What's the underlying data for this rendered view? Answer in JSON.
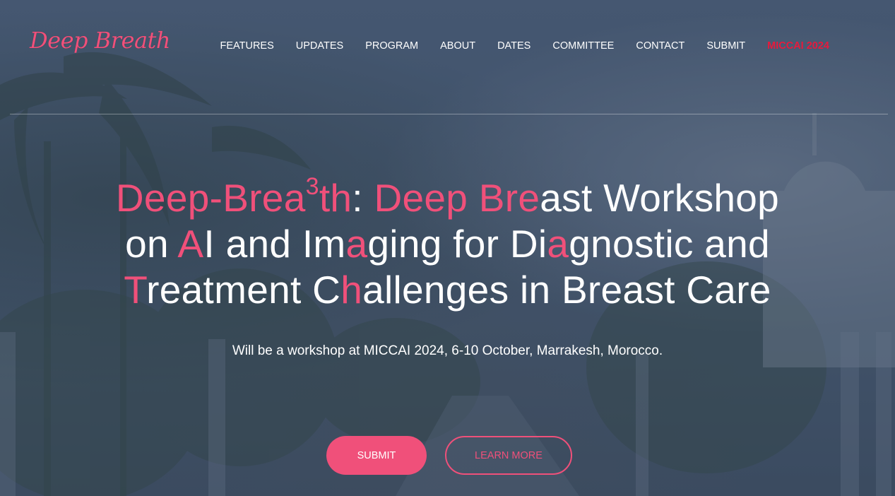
{
  "brand": {
    "logo_text": "Deep Breath"
  },
  "nav": {
    "items": [
      {
        "label": "FEATURES"
      },
      {
        "label": "UPDATES"
      },
      {
        "label": "PROGRAM"
      },
      {
        "label": "ABOUT"
      },
      {
        "label": "DATES"
      },
      {
        "label": "COMMITTEE"
      },
      {
        "label": "CONTACT"
      },
      {
        "label": "SUBMIT"
      },
      {
        "label": "MICCAI 2024"
      }
    ]
  },
  "hero": {
    "title_segments": [
      {
        "text": "Deep-Brea",
        "accent": true
      },
      {
        "text": "3",
        "accent": true,
        "sup": true
      },
      {
        "text": "th",
        "accent": true
      },
      {
        "text": ": ",
        "accent": false
      },
      {
        "text": "Deep Bre",
        "accent": true
      },
      {
        "text": "ast Workshop",
        "accent": false
      },
      {
        "br": true
      },
      {
        "text": "on ",
        "accent": false
      },
      {
        "text": "A",
        "accent": true
      },
      {
        "text": "I and Im",
        "accent": false
      },
      {
        "text": "a",
        "accent": true
      },
      {
        "text": "ging for Di",
        "accent": false
      },
      {
        "text": "a",
        "accent": true
      },
      {
        "text": "gnostic and",
        "accent": false
      },
      {
        "br": true
      },
      {
        "text": "T",
        "accent": true
      },
      {
        "text": "reatment C",
        "accent": false
      },
      {
        "text": "h",
        "accent": true
      },
      {
        "text": "allenges in Breast Care",
        "accent": false
      }
    ],
    "subtitle": "Will be a workshop at MICCAI 2024, 6-10 October, Marrakesh, Morocco.",
    "submit_label": "SUBMIT",
    "learn_more_label": "LEARN MORE"
  },
  "colors": {
    "accent": "#f0507a",
    "nav_highlight": "#e8193c",
    "text": "#ffffff"
  }
}
